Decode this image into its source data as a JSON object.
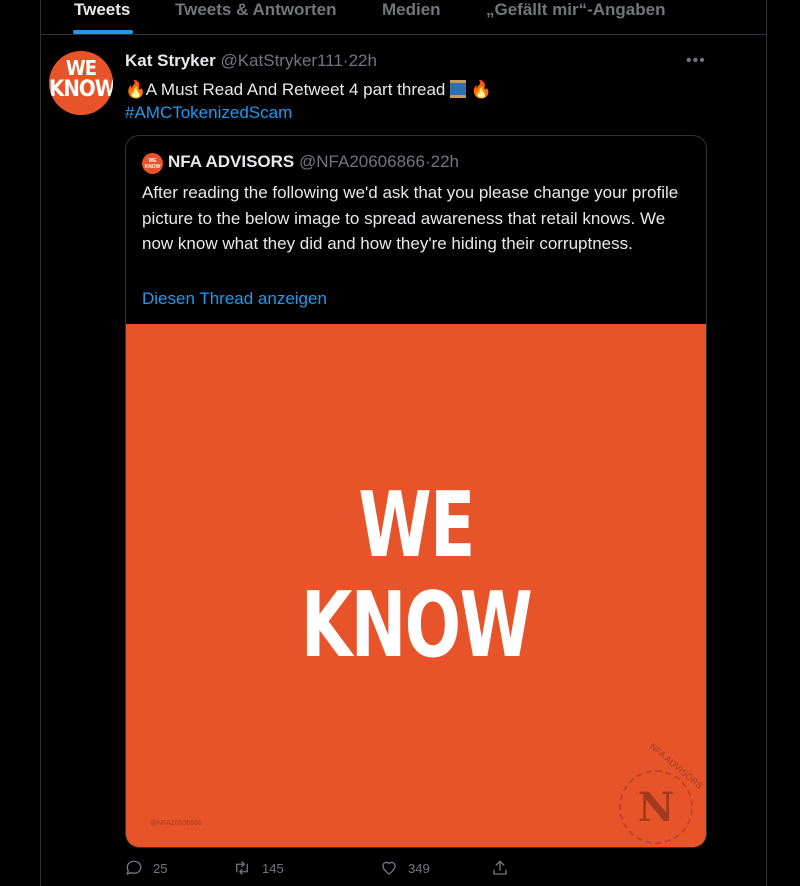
{
  "tabs": [
    {
      "label": "Tweets",
      "active": true
    },
    {
      "label": "Tweets & Antworten"
    },
    {
      "label": "Medien"
    },
    {
      "label": "„Gefällt mir“-Angaben"
    }
  ],
  "tweet": {
    "avatar_text": [
      "WE",
      "KNOW"
    ],
    "author_name": "Kat Stryker",
    "author_handle": "@KatStryker111",
    "separator": "·",
    "time": "22h",
    "more_icon": "ellipsis-icon",
    "text": "A Must Read And Retweet 4 part thread",
    "text_icons": [
      "fire-emoji",
      "spool-emoji",
      "fire-emoji"
    ],
    "hashtag": "#AMCTokenizedScam",
    "quote": {
      "avatar_text": "WE KNOW",
      "name": "NFA ADVISORS",
      "handle": "@NFA20606866",
      "separator": "·",
      "time": "22h",
      "text": "After reading the following we'd ask that you please change your profile picture to the below image to spread awareness that retail knows. We now know what they did and how they're hiding their corruptness.",
      "show_thread": "Diesen Thread anzeigen",
      "image": {
        "headline_line1": "WE",
        "headline_line2": "KNOW",
        "watermark": "@NFA20606866",
        "seal_letter": "N",
        "seal_text": "NFA ADVISORS",
        "background": "#e8542a"
      }
    },
    "actions": {
      "reply_count": "25",
      "retweet_count": "145",
      "like_count": "349"
    }
  },
  "colors": {
    "background": "#000000",
    "accent": "#1d9bf0",
    "muted": "#71767b",
    "text": "#e7e9ea",
    "border": "#2f3336"
  }
}
